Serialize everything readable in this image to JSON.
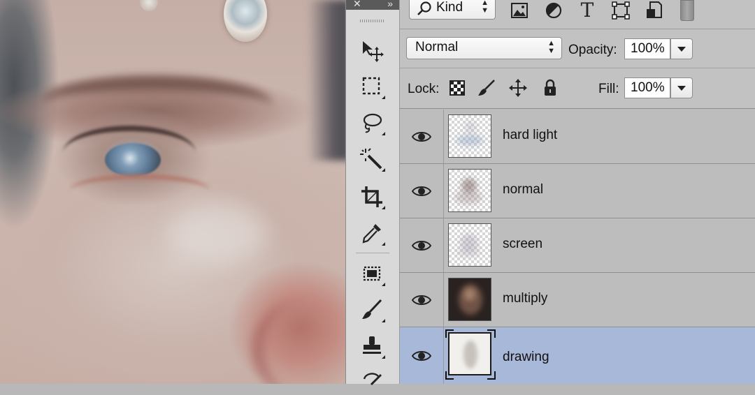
{
  "tools_panel": {
    "close_glyph": "✕",
    "collapse_glyph": "»",
    "tools": [
      {
        "name": "move-tool",
        "icon": "move-icon"
      },
      {
        "name": "marquee-tool",
        "icon": "rectangular-marquee-icon"
      },
      {
        "name": "lasso-tool",
        "icon": "lasso-icon"
      },
      {
        "name": "magic-wand-tool",
        "icon": "magic-wand-icon"
      },
      {
        "name": "crop-tool",
        "icon": "crop-icon"
      },
      {
        "name": "eyedropper-tool",
        "icon": "eyedropper-icon"
      },
      {
        "name": "healing-tool",
        "icon": "patch-icon"
      },
      {
        "name": "brush-tool",
        "icon": "brush-icon"
      },
      {
        "name": "stamp-tool",
        "icon": "clone-stamp-icon"
      },
      {
        "name": "history-brush-tool",
        "icon": "history-brush-icon"
      }
    ]
  },
  "layers_panel": {
    "filter": {
      "kind_label": "Kind"
    },
    "blend_mode": "Normal",
    "opacity_label": "Opacity:",
    "opacity_value": "100%",
    "lock_label": "Lock:",
    "fill_label": "Fill:",
    "fill_value": "100%",
    "layers": [
      {
        "name": "hard light",
        "visible": true,
        "selected": false
      },
      {
        "name": "normal",
        "visible": true,
        "selected": false
      },
      {
        "name": "screen",
        "visible": true,
        "selected": false
      },
      {
        "name": "multiply",
        "visible": true,
        "selected": false
      },
      {
        "name": "drawing",
        "visible": true,
        "selected": true
      }
    ]
  },
  "colors": {
    "selected_row": "#a8b8d8",
    "panel_bg": "#bdbdbd"
  }
}
